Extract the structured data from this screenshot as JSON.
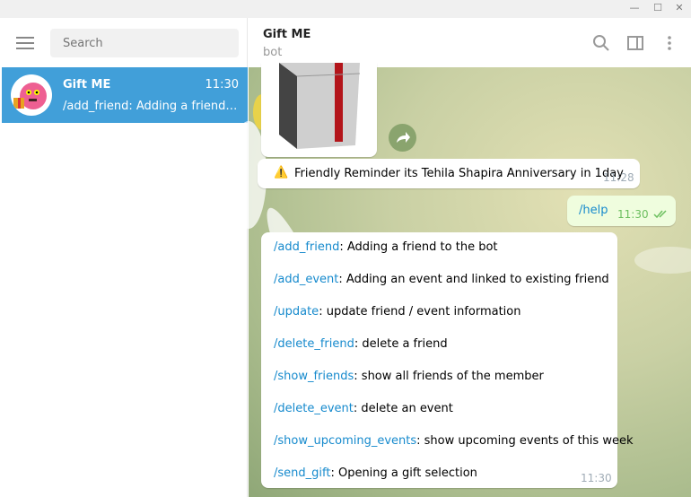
{
  "window": {
    "minimize": "—",
    "maximize": "☐",
    "close": "✕"
  },
  "sidebar": {
    "search_placeholder": "Search",
    "chats": [
      {
        "name": "Gift ME",
        "time": "11:30",
        "preview": "/add_friend:  Adding a friend to the bot"
      }
    ]
  },
  "header": {
    "title": "Gift ME",
    "subtitle": "bot"
  },
  "messages": {
    "reminder": {
      "icon": "⚠️",
      "text": "Friendly Reminder its Tehila Shapira Anniversary in 1day",
      "time": "11:28"
    },
    "outgoing": {
      "text": "/help",
      "time": "11:30",
      "status": "read"
    },
    "help": {
      "time": "11:30",
      "lines": [
        {
          "cmd": "/add_friend",
          "desc": ":  Adding a friend to the bot"
        },
        {
          "cmd": "/add_event",
          "desc": ":  Adding an event and linked to existing friend"
        },
        {
          "cmd": "/update",
          "desc": ":  update friend / event information"
        },
        {
          "cmd": "/delete_friend",
          "desc": ":  delete a friend"
        },
        {
          "cmd": "/show_friends",
          "desc": ":  show all friends of the member"
        },
        {
          "cmd": "/delete_event",
          "desc": ":  delete an event"
        },
        {
          "cmd": "/show_upcoming_events",
          "desc": ":  show upcoming events of this week"
        },
        {
          "cmd": "/send_gift",
          "desc": ": Opening a gift selection"
        }
      ]
    }
  },
  "colors": {
    "accent": "#419fd9",
    "link": "#168acd",
    "outgoing_bubble": "#effdde"
  }
}
